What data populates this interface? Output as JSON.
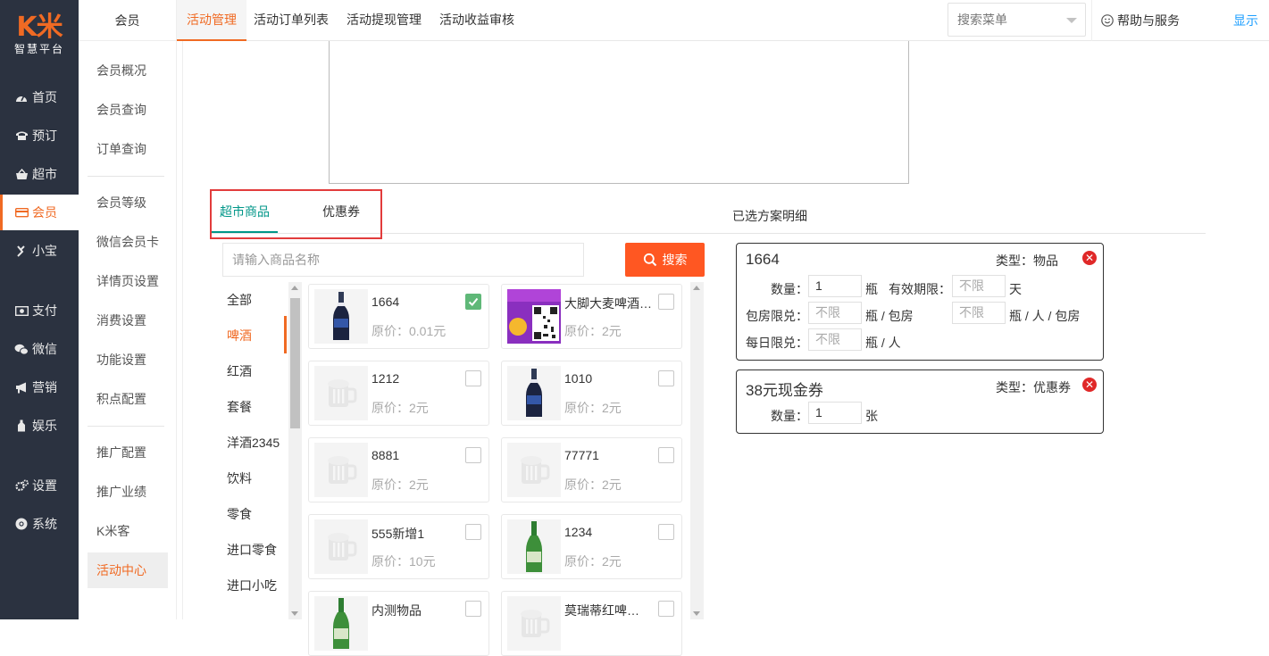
{
  "brand": {
    "mark": "K米",
    "sub": "智慧平台",
    "color": "#f06a23"
  },
  "sidebar": {
    "items": [
      {
        "label": "首页",
        "icon": "dashboard-icon"
      },
      {
        "label": "预订",
        "icon": "phone-icon"
      },
      {
        "label": "超市",
        "icon": "basket-icon"
      },
      {
        "label": "会员",
        "icon": "card-icon",
        "active": true
      },
      {
        "label": "小宝",
        "icon": "xiaobao-icon"
      },
      {
        "label": "支付",
        "icon": "cash-icon"
      },
      {
        "label": "微信",
        "icon": "wechat-icon"
      },
      {
        "label": "营销",
        "icon": "megaphone-icon"
      },
      {
        "label": "娱乐",
        "icon": "bottle-icon"
      },
      {
        "label": "设置",
        "icon": "gears-icon"
      },
      {
        "label": "系统",
        "icon": "chrome-icon"
      }
    ]
  },
  "submenu": {
    "header": "会员",
    "items": [
      {
        "label": "会员概况"
      },
      {
        "label": "会员查询"
      },
      {
        "label": "订单查询"
      },
      {
        "label": "会员等级"
      },
      {
        "label": "微信会员卡"
      },
      {
        "label": "详情页设置"
      },
      {
        "label": "消费设置"
      },
      {
        "label": "功能设置"
      },
      {
        "label": "积点配置"
      },
      {
        "label": "推广配置"
      },
      {
        "label": "推广业绩"
      },
      {
        "label": "K米客"
      },
      {
        "label": "活动中心",
        "active": true
      }
    ]
  },
  "topnav": {
    "tabs": [
      {
        "label": "活动管理",
        "active": true
      },
      {
        "label": "活动订单列表"
      },
      {
        "label": "活动提现管理"
      },
      {
        "label": "活动收益审核"
      }
    ],
    "search_menu": "搜索菜单",
    "help": "帮助与服务",
    "show": "显示"
  },
  "main": {
    "tabs": [
      {
        "label": "超市商品",
        "active": true
      },
      {
        "label": "优惠券"
      }
    ],
    "detail_title": "已选方案明细",
    "search_placeholder": "请输入商品名称",
    "search_button": "搜索",
    "categories": [
      {
        "label": "全部"
      },
      {
        "label": "啤酒",
        "active": true
      },
      {
        "label": "红酒"
      },
      {
        "label": "套餐"
      },
      {
        "label": "洋酒2345"
      },
      {
        "label": "饮料"
      },
      {
        "label": "零食"
      },
      {
        "label": "进口零食"
      },
      {
        "label": "进口小吃"
      }
    ],
    "products": [
      {
        "name": "1664",
        "price": "原价：0.01元",
        "checked": true,
        "img": "dark-bottle"
      },
      {
        "name": "大脚大麦啤酒…",
        "price": "原价：2元",
        "checked": false,
        "img": "poster"
      },
      {
        "name": "1212",
        "price": "原价：2元",
        "checked": false,
        "img": "placeholder"
      },
      {
        "name": "1010",
        "price": "原价：2元",
        "checked": false,
        "img": "dark-bottle"
      },
      {
        "name": "8881",
        "price": "原价：2元",
        "checked": false,
        "img": "placeholder"
      },
      {
        "name": "77771",
        "price": "原价：2元",
        "checked": false,
        "img": "placeholder"
      },
      {
        "name": "555新增1",
        "price": "原价：10元",
        "checked": false,
        "img": "placeholder"
      },
      {
        "name": "1234",
        "price": "原价：2元",
        "checked": false,
        "img": "green-bottle"
      },
      {
        "name": "内测物品",
        "price": "",
        "checked": false,
        "img": "green-bottle"
      },
      {
        "name": "莫瑞蒂红啤…",
        "price": "",
        "checked": false,
        "img": "placeholder"
      }
    ],
    "plans": [
      {
        "name": "1664",
        "type": "类型：物品",
        "qty_label": "数量：",
        "qty": "1",
        "qty_unit": "瓶",
        "expire_label": "有效期限：",
        "expire": "不限",
        "expire_unit": "天",
        "room_label": "包房限兑：",
        "room": "不限",
        "room_unit": "瓶 / 包房",
        "person": "不限",
        "person_unit": "瓶 / 人 / 包房",
        "daily_label": "每日限兑：",
        "daily": "不限",
        "daily_unit": "瓶 / 人"
      },
      {
        "name": "38元现金券",
        "type": "类型：优惠券",
        "qty_label": "数量：",
        "qty": "1",
        "qty_unit": "张"
      }
    ],
    "close_glyph": "✕"
  },
  "colors": {
    "accent": "#f06a23",
    "tab_active": "#009688",
    "search_btn": "#ff5722",
    "link": "#1e9fff",
    "danger": "#e02828",
    "check": "#5fb878"
  }
}
